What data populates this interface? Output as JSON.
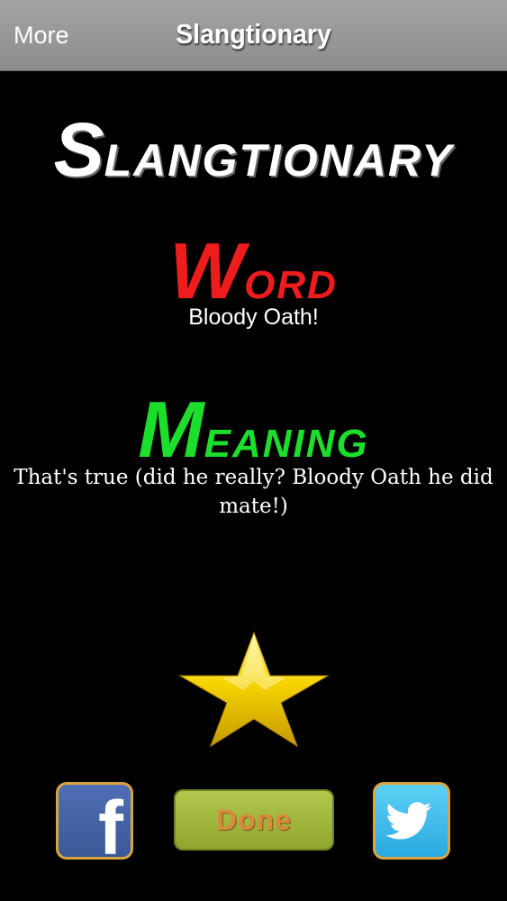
{
  "navbar": {
    "more_label": "More",
    "title": "Slangtionary"
  },
  "logo": {
    "first_letter": "S",
    "rest": "LANGTIONARY"
  },
  "word_section": {
    "heading_first_letter": "W",
    "heading_rest": "ORD",
    "value": "Bloody Oath!"
  },
  "meaning_section": {
    "heading_first_letter": "M",
    "heading_rest": "EANING",
    "value": "That's true (did he really? Bloody Oath he did mate!)"
  },
  "actions": {
    "favorite_icon": "star-icon",
    "facebook_icon": "facebook-icon",
    "facebook_letter": "f",
    "done_label": "Done",
    "twitter_icon": "twitter-icon"
  },
  "colors": {
    "navbar": "#a5a2a2",
    "background": "#000000",
    "word_heading": "#ee1c1c",
    "meaning_heading": "#1cdf2c",
    "done_button": "#a2b83c",
    "done_text": "#d98a3c",
    "facebook": "#3b5998",
    "twitter": "#29a9e1",
    "star": "#f5d400"
  }
}
